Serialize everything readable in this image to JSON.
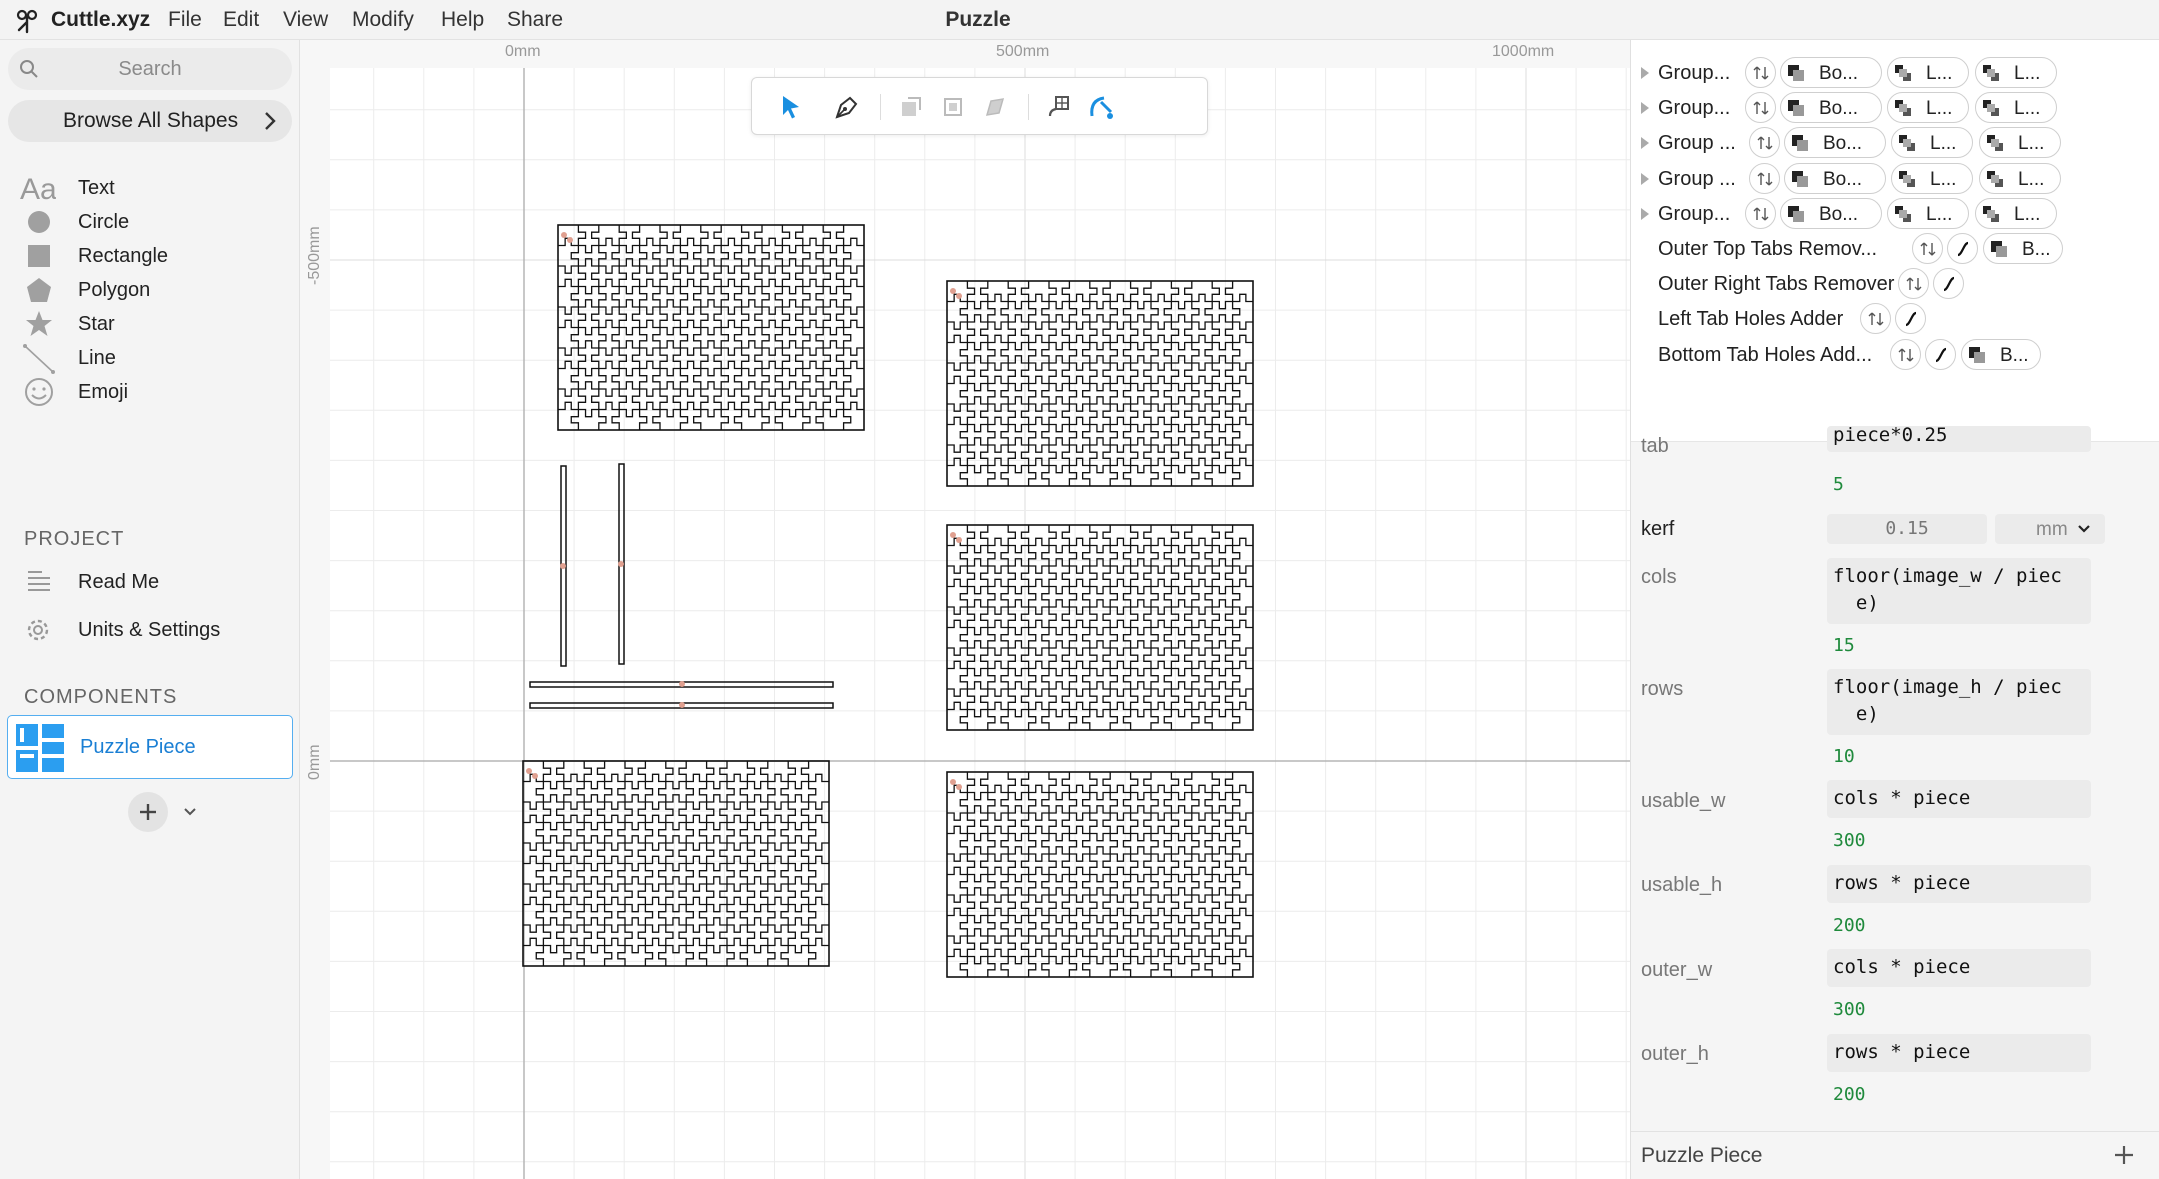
{
  "app": {
    "name": "Cuttle.xyz",
    "document_title": "Puzzle"
  },
  "menu": [
    "File",
    "Edit",
    "View",
    "Modify",
    "Help",
    "Share"
  ],
  "sidebar": {
    "search_placeholder": "Search",
    "browse_label": "Browse All Shapes",
    "shapes": [
      {
        "label": "Text",
        "icon": "text-aa-icon"
      },
      {
        "label": "Circle",
        "icon": "circle-icon"
      },
      {
        "label": "Rectangle",
        "icon": "rectangle-icon"
      },
      {
        "label": "Polygon",
        "icon": "polygon-icon"
      },
      {
        "label": "Star",
        "icon": "star-icon"
      },
      {
        "label": "Line",
        "icon": "line-icon"
      },
      {
        "label": "Emoji",
        "icon": "emoji-icon"
      }
    ],
    "project_heading": "PROJECT",
    "project_items": [
      {
        "label": "Read Me",
        "icon": "document-lines-icon"
      },
      {
        "label": "Units & Settings",
        "icon": "gear-icon"
      }
    ],
    "components_heading": "COMPONENTS",
    "component": {
      "label": "Puzzle Piece",
      "icon": "puzzle-piece-component-icon"
    }
  },
  "rulers": {
    "top": [
      "0mm",
      "500mm",
      "1000mm"
    ],
    "left": [
      "-500mm",
      "0mm"
    ]
  },
  "toolbar": {
    "tools": [
      "select-arrow-icon",
      "pen-tool-icon",
      "transform-icon-1",
      "transform-icon-2",
      "transform-icon-3",
      "node-edit-icon",
      "magnet-snap-icon"
    ],
    "accent": "#1a8fe0"
  },
  "layers": [
    {
      "name": "Group...",
      "chips": [
        "Bo...",
        "L...",
        "L..."
      ],
      "expandable": true
    },
    {
      "name": "Group...",
      "chips": [
        "Bo...",
        "L...",
        "L..."
      ],
      "expandable": true
    },
    {
      "name": "Group ...",
      "chips": [
        "Bo...",
        "L...",
        "L..."
      ],
      "expandable": true
    },
    {
      "name": "Group ...",
      "chips": [
        "Bo...",
        "L...",
        "L..."
      ],
      "expandable": true
    },
    {
      "name": "Group...",
      "chips": [
        "Bo...",
        "L...",
        "L..."
      ],
      "expandable": true
    },
    {
      "name": "Outer Top Tabs Remov...",
      "chips": [
        "B..."
      ],
      "expandable": false
    },
    {
      "name": "Outer Right Tabs Remover",
      "chips": [],
      "expandable": false
    },
    {
      "name": "Left Tab Holes Adder",
      "chips": [],
      "expandable": false
    },
    {
      "name": "Bottom Tab Holes Add...",
      "chips": [
        "B..."
      ],
      "expandable": false
    }
  ],
  "params": {
    "tab": {
      "name": "tab",
      "expr": "piece*0.25",
      "value": "5"
    },
    "kerf": {
      "name": "kerf",
      "value": "0.15",
      "unit": "mm"
    },
    "cols": {
      "name": "cols",
      "expr": "floor(image_w / piec\n  e)",
      "value": "15"
    },
    "rows": {
      "name": "rows",
      "expr": "floor(image_h / piec\n  e)",
      "value": "10"
    },
    "usable_w": {
      "name": "usable_w",
      "expr": "cols * piece",
      "value": "300"
    },
    "usable_h": {
      "name": "usable_h",
      "expr": "rows * piece",
      "value": "200"
    },
    "outer_w": {
      "name": "outer_w",
      "expr": "cols * piece",
      "value": "300"
    },
    "outer_h": {
      "name": "outer_h",
      "expr": "rows * piece",
      "value": "200"
    }
  },
  "footer": {
    "component_name": "Puzzle Piece"
  },
  "colors": {
    "accent": "#1a8fe0",
    "value_green": "#1f8a3c",
    "selection_border": "#55aef0"
  }
}
